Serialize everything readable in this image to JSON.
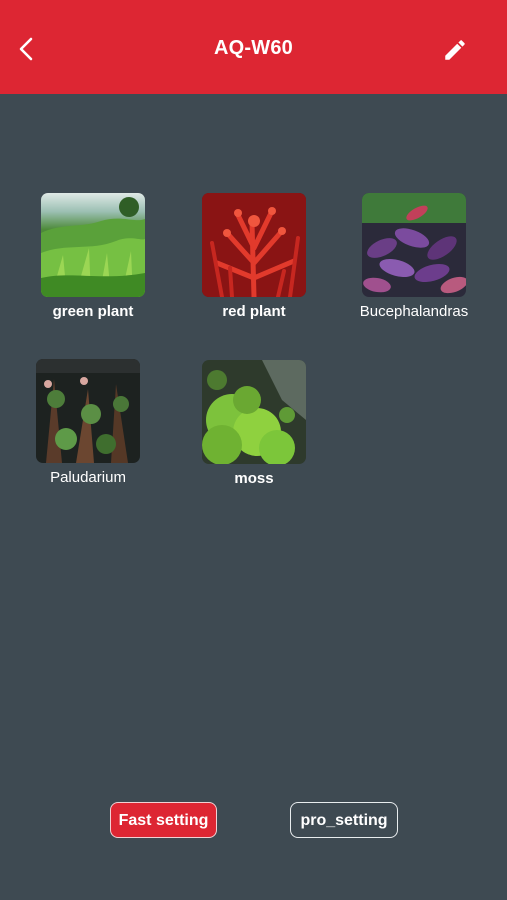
{
  "header": {
    "title": "AQ-W60",
    "back_icon": "chevron-left-icon",
    "edit_icon": "pencil-icon",
    "background": "#dd2633"
  },
  "presets": [
    {
      "label": "green plant"
    },
    {
      "label": "red plant"
    },
    {
      "label": "Bucephalandras"
    },
    {
      "label": "Paludarium"
    },
    {
      "label": "moss"
    }
  ],
  "footer": {
    "fast_setting_label": "Fast setting",
    "pro_setting_label": "pro_setting"
  },
  "colors": {
    "background": "#3e4a52",
    "accent": "#dd2633"
  }
}
